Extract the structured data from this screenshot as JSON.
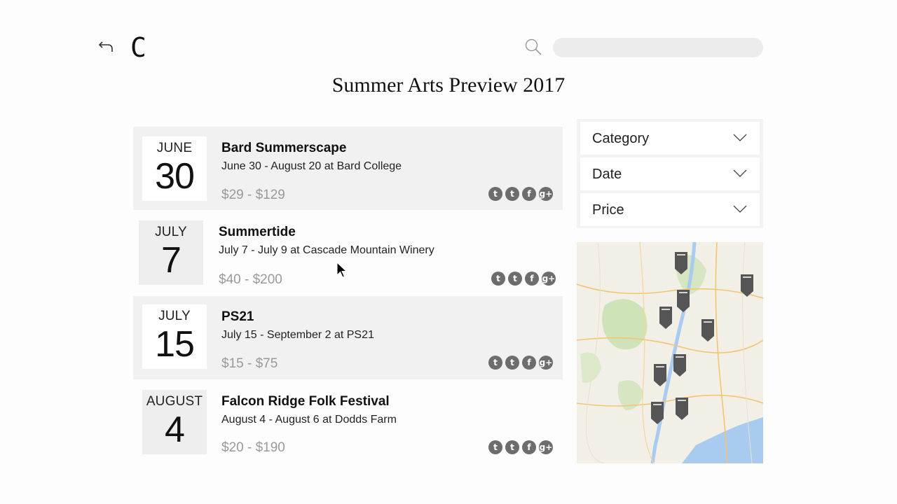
{
  "header": {
    "logo": "C",
    "search": {
      "placeholder": "",
      "value": ""
    }
  },
  "title": "Summer Arts Preview 2017",
  "events": [
    {
      "month": "JUNE",
      "day": "30",
      "name": "Bard Summerscape",
      "details": "June 30 - August 20 at Bard College",
      "price": "$29 - $129"
    },
    {
      "month": "JULY",
      "day": "7",
      "name": "Summertide",
      "details": "July 7 - July 9 at Cascade Mountain Winery",
      "price": "$40 - $200"
    },
    {
      "month": "JULY",
      "day": "15",
      "name": "PS21",
      "details": "July 15 - September 2 at PS21",
      "price": "$15 - $75"
    },
    {
      "month": "AUGUST",
      "day": "4",
      "name": "Falcon Ridge Folk Festival",
      "details": "August 4 - August 6 at Dodds Farm",
      "price": "$20 - $190"
    }
  ],
  "social_icons": [
    "twitter-icon",
    "tumblr-icon",
    "facebook-icon",
    "google-plus-icon"
  ],
  "filters": [
    {
      "label": "Category"
    },
    {
      "label": "Date"
    },
    {
      "label": "Price"
    }
  ],
  "colors": {
    "row_shade": "#f1f1f1",
    "price_gray": "#999999",
    "social_gray": "#6d6d6d",
    "map_land": "#f2efe6",
    "map_water": "#a8cbef",
    "map_marker": "#555555"
  }
}
